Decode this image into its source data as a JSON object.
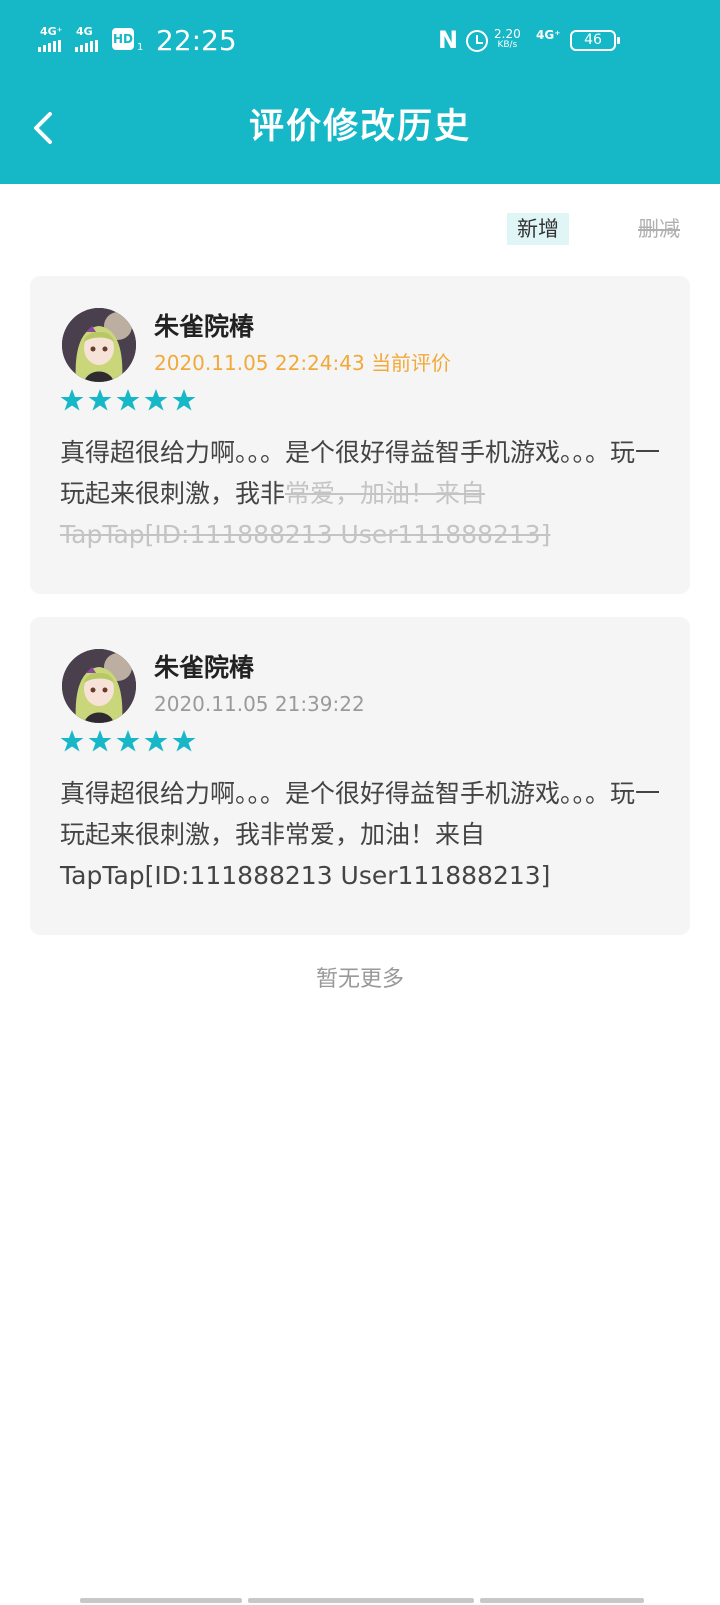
{
  "status_bar": {
    "signal1": "4G⁺",
    "signal2": "4G",
    "hd": "HD",
    "hd_sub": "1",
    "time": "22:25",
    "nfc": "N",
    "speed_value": "2.20",
    "speed_unit": "KB/s",
    "network": "4G⁺",
    "battery": "46"
  },
  "header": {
    "title": "评价修改历史"
  },
  "filters": {
    "add": "新增",
    "delete": "删减"
  },
  "reviews": [
    {
      "name": "朱雀院椿",
      "date": "2020.11.05 22:24:43",
      "current_label": "当前评价",
      "rating": 5,
      "text_kept": "真得超很给力啊。。。是个很好得益智手机游戏。。。玩一玩起来很刺激，我非",
      "text_deleted": "常爱，加油！来自TapTap[ID:111888213 User111888213]"
    },
    {
      "name": "朱雀院椿",
      "date": "2020.11.05 21:39:22",
      "rating": 5,
      "text": "真得超很给力啊。。。是个很好得益智手机游戏。。。玩一玩起来很刺激，我非常爱，加油！来自TapTap[ID:111888213 User111888213]"
    }
  ],
  "footer": {
    "no_more": "暂无更多"
  },
  "colors": {
    "accent": "#16b7c7",
    "star": "#16b7c7",
    "current_date": "#f2a93a",
    "card_bg": "#f5f5f5"
  },
  "icons": {
    "back": "chevron-left-icon",
    "star": "star-icon",
    "alarm": "alarm-icon",
    "battery": "battery-icon"
  }
}
